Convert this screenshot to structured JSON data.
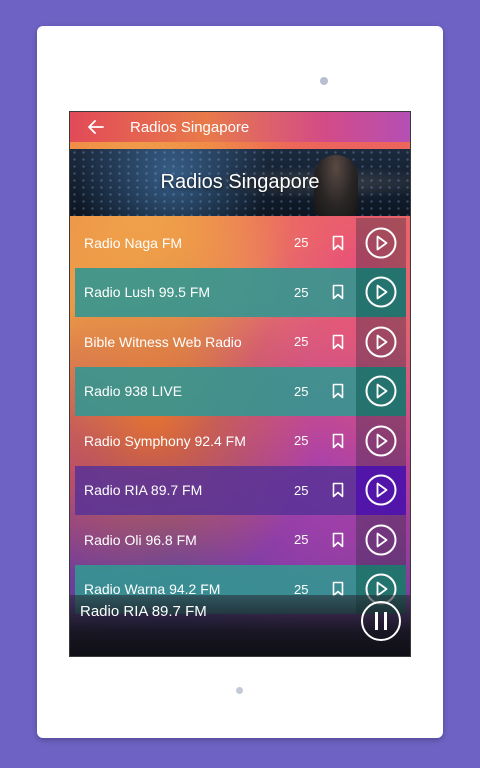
{
  "appbar": {
    "title": "Radios Singapore",
    "back_icon": "arrow-left-icon"
  },
  "banner": {
    "title": "Radios Singapore"
  },
  "stations": [
    {
      "name": "Radio Naga FM",
      "count": "25",
      "style": "plain"
    },
    {
      "name": "Radio Lush 99.5 FM",
      "count": "25",
      "style": "teal"
    },
    {
      "name": "Bible Witness Web Radio",
      "count": "25",
      "style": "plain"
    },
    {
      "name": "Radio 938 LIVE",
      "count": "25",
      "style": "teal"
    },
    {
      "name": "Radio Symphony 92.4 FM",
      "count": "25",
      "style": "plain"
    },
    {
      "name": "Radio RIA 89.7 FM",
      "count": "25",
      "style": "purple"
    },
    {
      "name": "Radio Oli 96.8 FM",
      "count": "25",
      "style": "plain"
    },
    {
      "name": "Radio Warna 94.2 FM",
      "count": "25",
      "style": "teal"
    }
  ],
  "player": {
    "now_playing": "Radio RIA 89.7 FM",
    "control_icon": "pause-icon"
  },
  "colors": {
    "device_background": "#6e62c4",
    "teal_row": "#349691",
    "purple_row": "#583296"
  }
}
